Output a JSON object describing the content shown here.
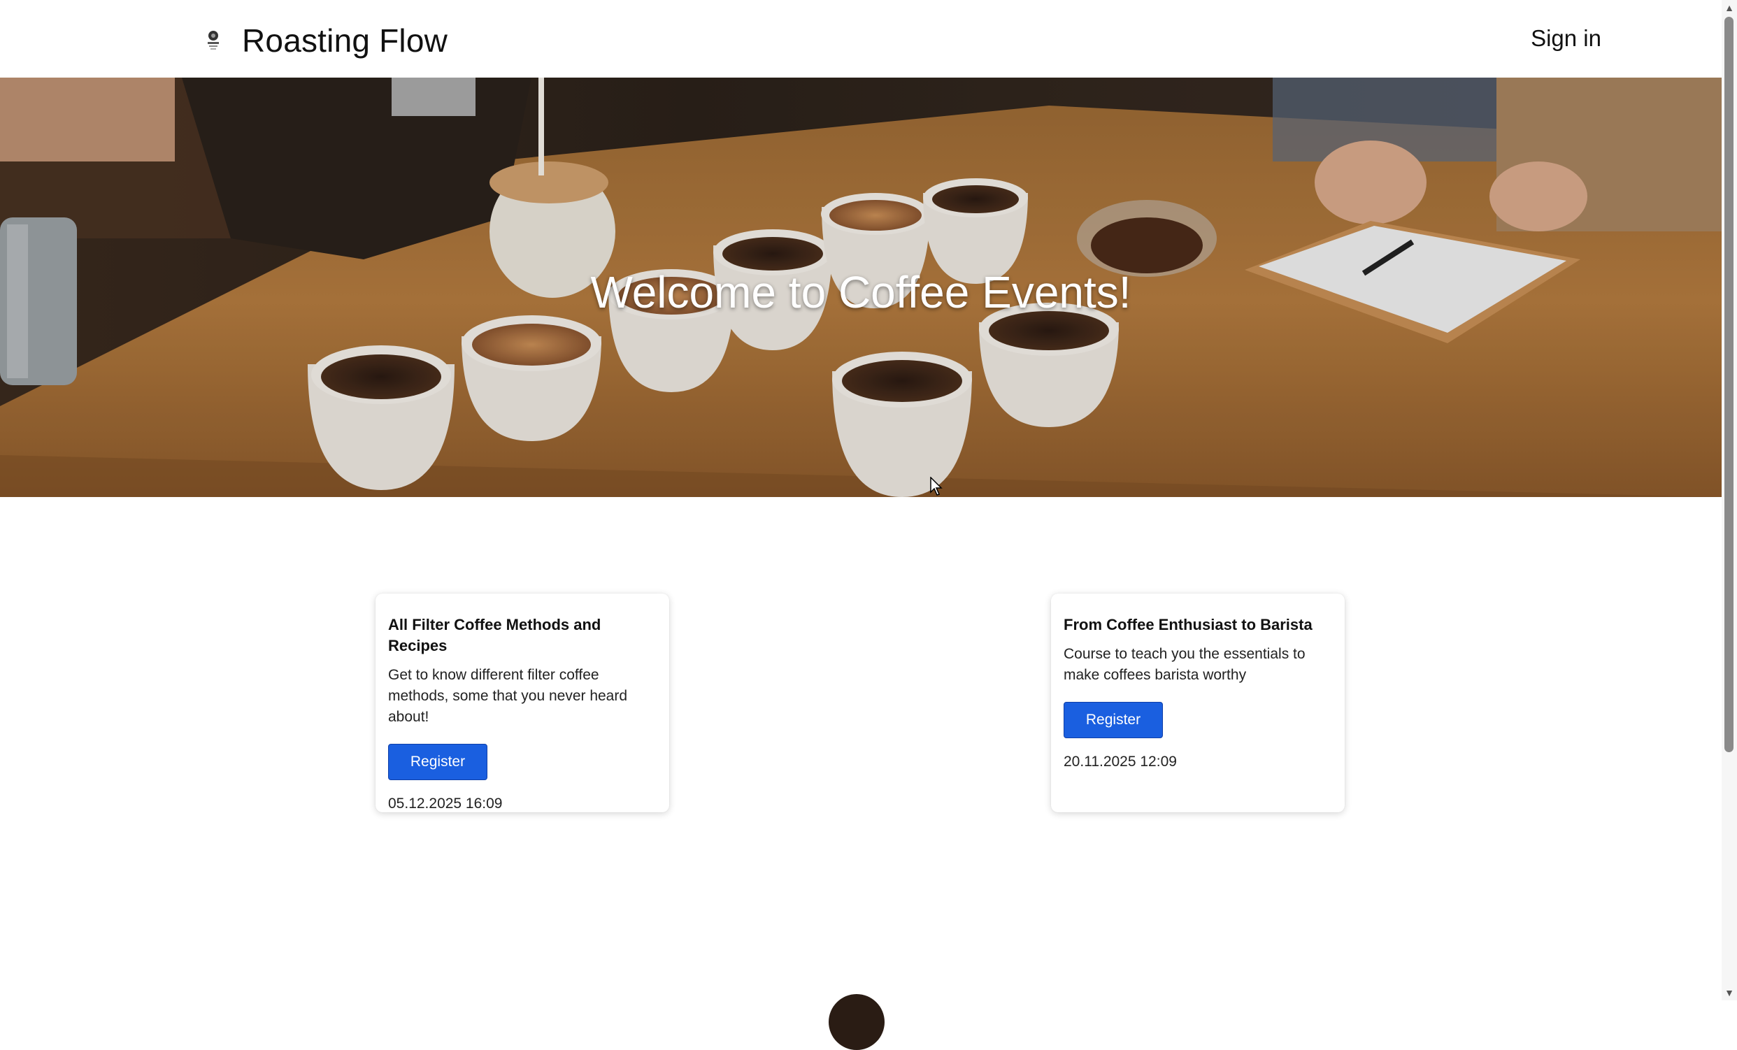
{
  "header": {
    "brand_name": "Roasting Flow",
    "sign_in_label": "Sign in"
  },
  "hero": {
    "title": "Welcome to Coffee Events!"
  },
  "events": [
    {
      "title": "All Filter Coffee Methods and Recipes",
      "description": "Get to know different filter coffee methods, some that you never heard about!",
      "register_label": "Register",
      "date": "05.12.2025 16:09"
    },
    {
      "title": "From Coffee Enthusiast to Barista",
      "description": "Course to teach you the essentials to make coffees barista worthy",
      "register_label": "Register",
      "date": "20.11.2025 12:09"
    }
  ],
  "colors": {
    "primary_button": "#1a5fe0",
    "hero_text": "#ffffff"
  },
  "icons": {
    "logo": "coffee-logo-icon",
    "scroll_up": "scroll-up-arrow-icon",
    "scroll_down": "scroll-down-arrow-icon"
  }
}
